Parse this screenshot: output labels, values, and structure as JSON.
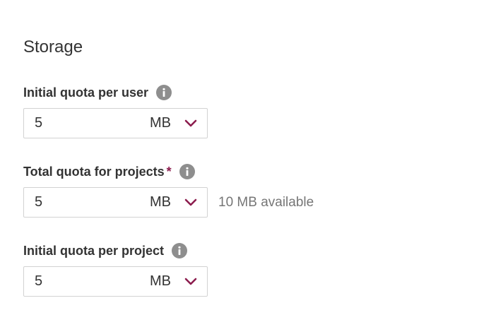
{
  "section": {
    "title": "Storage"
  },
  "fields": [
    {
      "label": "Initial quota per user",
      "required": false,
      "value": "5",
      "unit": "MB",
      "info_icon": "info-icon"
    },
    {
      "label": "Total quota for projects",
      "required": true,
      "required_marker": "*",
      "value": "5",
      "unit": "MB",
      "available": "10 MB available",
      "info_icon": "info-icon"
    },
    {
      "label": "Initial quota per project",
      "required": false,
      "value": "5",
      "unit": "MB",
      "info_icon": "info-icon"
    }
  ],
  "colors": {
    "accent": "#8c1d4e",
    "info_icon": "#8e8e8e",
    "border": "#d2d2d2",
    "muted_text": "#767676"
  }
}
